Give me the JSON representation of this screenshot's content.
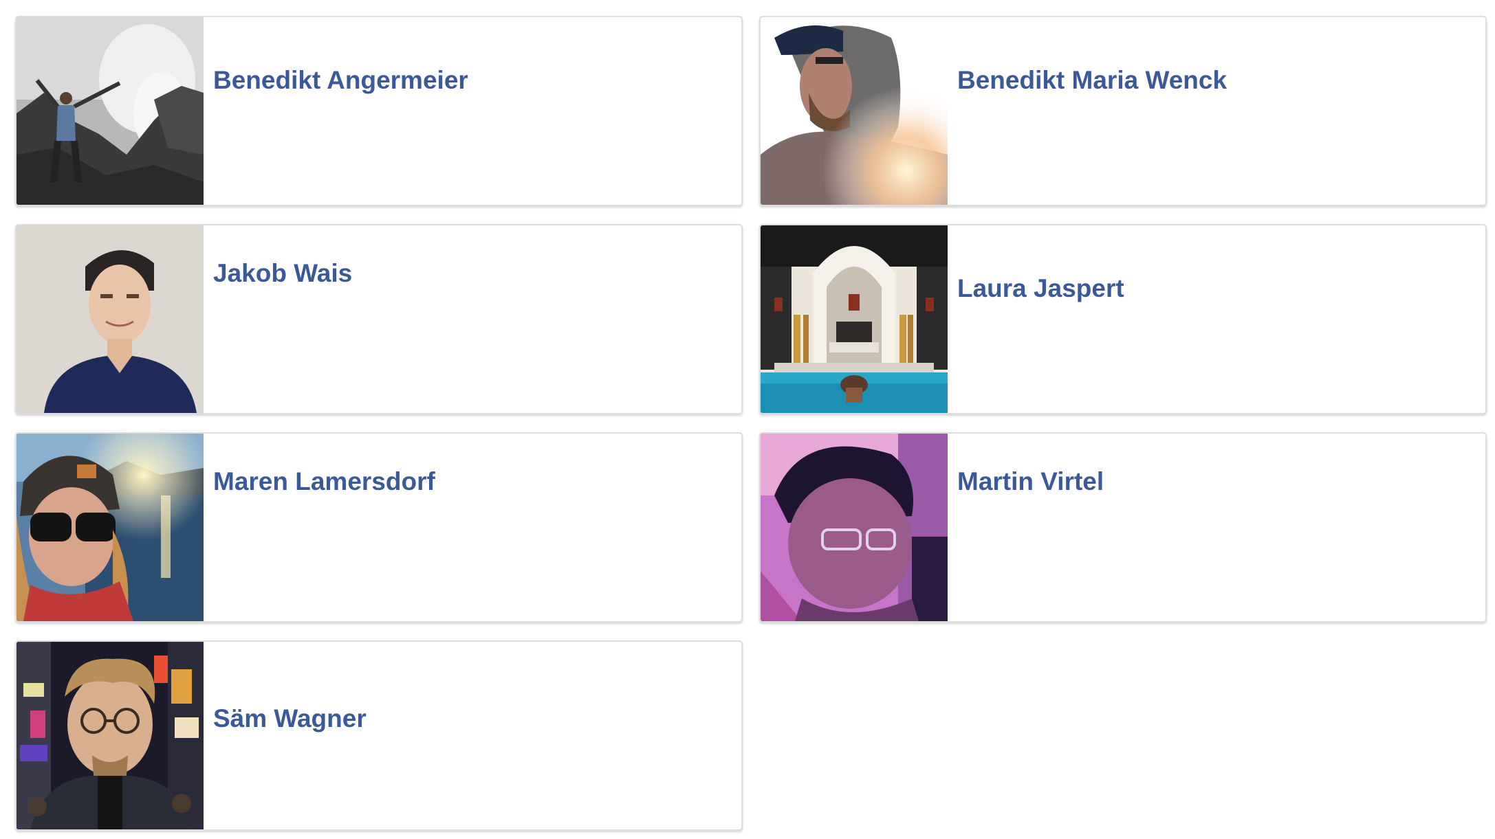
{
  "people": [
    {
      "name": "Benedikt Angermeier",
      "photo": "photo-rocky-waterfall"
    },
    {
      "name": "Benedikt Maria Wenck",
      "photo": "photo-hoodie-sunlight"
    },
    {
      "name": "Jakob Wais",
      "photo": "photo-portrait-shirt"
    },
    {
      "name": "Laura Jaspert",
      "photo": "photo-moorish-pool"
    },
    {
      "name": "Maren Lamersdorf",
      "photo": "photo-beanie-lake"
    },
    {
      "name": "Martin Virtel",
      "photo": "photo-glasses-closeup"
    },
    {
      "name": "Säm Wagner",
      "photo": "photo-city-night"
    }
  ],
  "colors": {
    "link": "#3b5998",
    "card_border": "#dddddd"
  }
}
